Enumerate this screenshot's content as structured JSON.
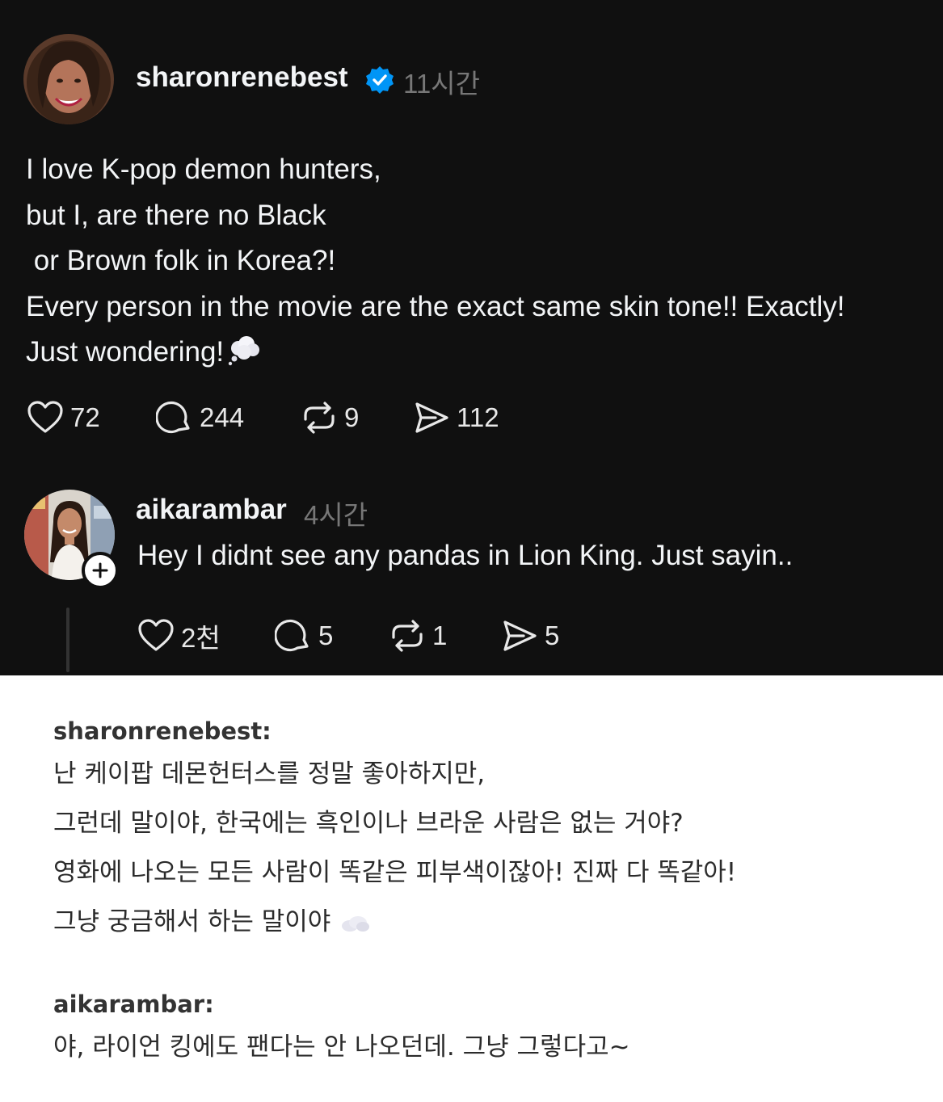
{
  "post": {
    "username": "sharonrenebest",
    "time": "11시간",
    "lines": [
      "I love K-pop demon hunters,",
      "but I, are there no Black",
      " or Brown folk in Korea?!",
      "Every person in the movie are the exact same skin tone!! Exactly!",
      "Just wondering!"
    ],
    "emoji": "thought-balloon",
    "likes": "72",
    "comments": "244",
    "reposts": "9",
    "shares": "112"
  },
  "reply": {
    "username": "aikarambar",
    "time": "4시간",
    "text": "Hey I didnt see any pandas in Lion King. Just sayin..",
    "likes": "2천",
    "comments": "5",
    "reposts": "1",
    "shares": "5"
  },
  "translation": {
    "post_name": "sharonrenebest:",
    "post_lines": [
      "난 케이팝 데몬헌터스를 정말 좋아하지만,",
      "그런데 말이야, 한국에는 흑인이나 브라운 사람은 없는 거야?",
      "영화에 나오는 모든 사람이 똑같은 피부색이잖아! 진짜 다 똑같아!",
      "그냥 궁금해서 하는 말이야"
    ],
    "reply_name": "aikarambar:",
    "reply_line": "야, 라이언 킹에도 팬다는 안 나오던데. 그냥 그렇다고~"
  },
  "colors": {
    "dark_bg": "#101010",
    "text": "#f3f5f7",
    "muted": "#777777",
    "verified": "#0095f6"
  }
}
